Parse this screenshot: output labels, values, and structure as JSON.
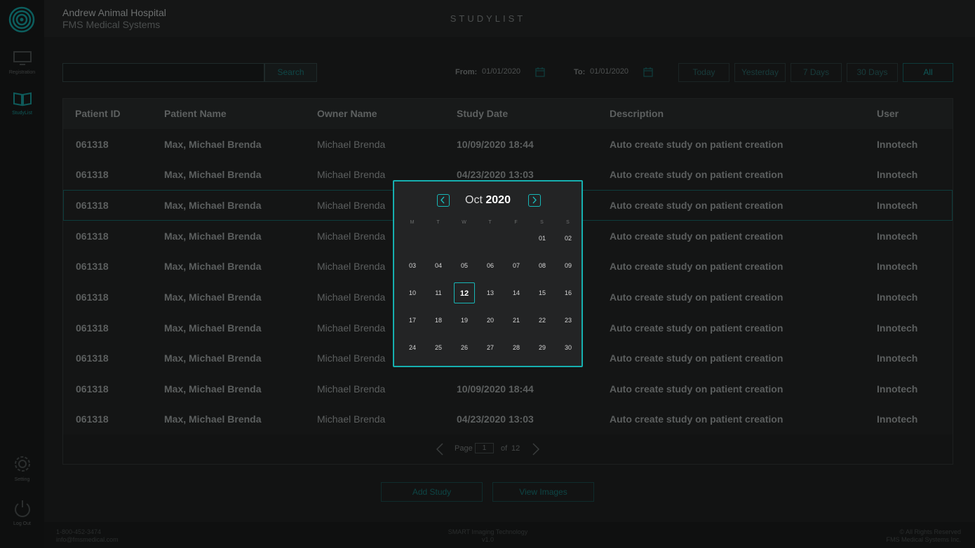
{
  "app": {
    "hospital_name": "Andrew Animal Hospital",
    "company": "FMS Medical Systems",
    "page_title": "STUDYLIST"
  },
  "sidebar": {
    "items": [
      {
        "label": "Registration",
        "icon": "monitor-icon"
      },
      {
        "label": "StudyList",
        "icon": "book-icon",
        "active": true
      },
      {
        "label": "Setting",
        "icon": "gear-icon"
      },
      {
        "label": "Log Out",
        "icon": "power-icon"
      }
    ]
  },
  "search": {
    "placeholder": "",
    "button_label": "Search"
  },
  "date_filter": {
    "from_label": "From:",
    "from_value": "01/01/2020",
    "to_label": "To:",
    "to_value": "01/01/2020",
    "quick_buttons": [
      "Today",
      "Yesterday",
      "7 Days",
      "30 Days",
      "All"
    ]
  },
  "table": {
    "headers": [
      "Patient ID",
      "Patient Name",
      "Owner Name",
      "Study Date",
      "Description",
      "User"
    ],
    "rows": [
      {
        "id": "061318",
        "patient": "Max, Michael Brenda",
        "owner": "Michael Brenda",
        "date": "10/09/2020  18:44",
        "desc": "Auto create study on patient creation",
        "user": "Innotech"
      },
      {
        "id": "061318",
        "patient": "Max, Michael Brenda",
        "owner": "Michael Brenda",
        "date": "04/23/2020  13:03",
        "desc": "Auto create study on patient creation",
        "user": "Innotech"
      },
      {
        "id": "061318",
        "patient": "Max, Michael Brenda",
        "owner": "Michael Brenda",
        "date": "",
        "desc": "Auto create study on patient creation",
        "user": "Innotech"
      },
      {
        "id": "061318",
        "patient": "Max, Michael Brenda",
        "owner": "Michael Brenda",
        "date": "",
        "desc": "Auto create study on patient creation",
        "user": "Innotech"
      },
      {
        "id": "061318",
        "patient": "Max, Michael Brenda",
        "owner": "Michael Brenda",
        "date": "",
        "desc": "Auto create study on patient creation",
        "user": "Innotech"
      },
      {
        "id": "061318",
        "patient": "Max, Michael Brenda",
        "owner": "Michael Brenda",
        "date": "",
        "desc": "Auto create study on patient creation",
        "user": "Innotech"
      },
      {
        "id": "061318",
        "patient": "Max, Michael Brenda",
        "owner": "Michael Brenda",
        "date": "",
        "desc": "Auto create study on patient creation",
        "user": "Innotech"
      },
      {
        "id": "061318",
        "patient": "Max, Michael Brenda",
        "owner": "Michael Brenda",
        "date": "",
        "desc": "Auto create study on patient creation",
        "user": "Innotech"
      },
      {
        "id": "061318",
        "patient": "Max, Michael Brenda",
        "owner": "Michael Brenda",
        "date": "10/09/2020  18:44",
        "desc": "Auto create study on patient creation",
        "user": "Innotech"
      },
      {
        "id": "061318",
        "patient": "Max, Michael Brenda",
        "owner": "Michael Brenda",
        "date": "04/23/2020  13:03",
        "desc": "Auto create study on patient creation",
        "user": "Innotech"
      }
    ]
  },
  "pagination": {
    "page_label": "Page",
    "current": "1",
    "of_label": "of",
    "total": "12"
  },
  "actions": {
    "add_study": "Add Study",
    "view_images": "View Images"
  },
  "footer": {
    "left_line1": "1-800-452-3474",
    "left_line2": "info@fmsmedical.com",
    "center_line1": "SMART Imaging Technology",
    "center_line2": "v1.0",
    "right_line1": "© All Rights Reserved",
    "right_line2": "FMS Medical Systems Inc."
  },
  "calendar": {
    "month": "Oct",
    "year": "2020",
    "weekdays": [
      "M",
      "T",
      "W",
      "T",
      "F",
      "S",
      "S"
    ],
    "weeks": [
      [
        "",
        "",
        "",
        "",
        "",
        "01",
        "02"
      ],
      [
        "03",
        "04",
        "05",
        "06",
        "07",
        "08",
        "09"
      ],
      [
        "10",
        "11",
        "12",
        "13",
        "14",
        "15",
        "16"
      ],
      [
        "17",
        "18",
        "19",
        "20",
        "21",
        "22",
        "23"
      ],
      [
        "24",
        "25",
        "26",
        "27",
        "28",
        "29",
        "30"
      ]
    ],
    "selected": "12"
  },
  "colors": {
    "accent": "#16b0b0",
    "background": "#121313"
  }
}
